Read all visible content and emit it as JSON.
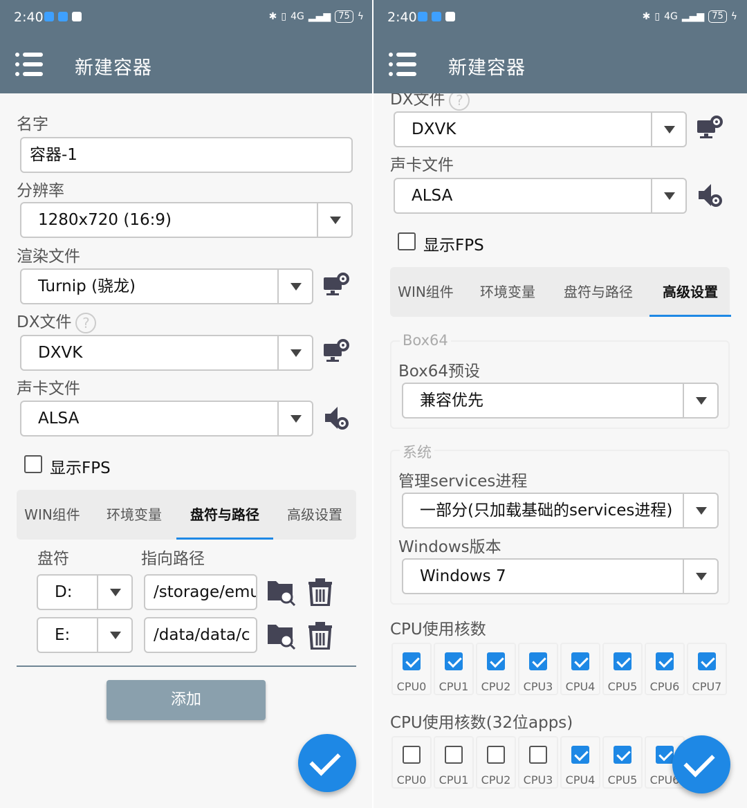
{
  "status": {
    "time": "2:40",
    "network": "4G",
    "battery": "75"
  },
  "appbar": {
    "title": "新建容器"
  },
  "left": {
    "name_label": "名字",
    "name_value": "容器-1",
    "resolution_label": "分辨率",
    "resolution_value": "1280x720 (16:9)",
    "renderer_label": "渲染文件",
    "renderer_value": "Turnip (骁龙)",
    "dx_label": "DX文件",
    "dx_value": "DXVK",
    "audio_label": "声卡文件",
    "audio_value": "ALSA",
    "fps_label": "显示FPS",
    "tabs": [
      "WIN组件",
      "环境变量",
      "盘符与路径",
      "高级设置"
    ],
    "drive_header": "盘符",
    "path_header": "指向路径",
    "drives": [
      {
        "letter": "D:",
        "path": "/storage/emu"
      },
      {
        "letter": "E:",
        "path": "/data/data/c"
      }
    ],
    "add_label": "添加"
  },
  "right": {
    "dx_label": "DX文件",
    "dx_value": "DXVK",
    "audio_label": "声卡文件",
    "audio_value": "ALSA",
    "fps_label": "显示FPS",
    "tabs": [
      "WIN组件",
      "环境变量",
      "盘符与路径",
      "高级设置"
    ],
    "box64_group": "Box64",
    "box64_label": "Box64预设",
    "box64_value": "兼容优先",
    "system_group": "系统",
    "services_label": "管理services进程",
    "services_value": "一部分(只加载基础的services进程)",
    "windows_label": "Windows版本",
    "windows_value": "Windows 7",
    "cpu_label": "CPU使用核数",
    "cpu_cores": [
      {
        "name": "CPU0",
        "checked": true
      },
      {
        "name": "CPU1",
        "checked": true
      },
      {
        "name": "CPU2",
        "checked": true
      },
      {
        "name": "CPU3",
        "checked": true
      },
      {
        "name": "CPU4",
        "checked": true
      },
      {
        "name": "CPU5",
        "checked": true
      },
      {
        "name": "CPU6",
        "checked": true
      },
      {
        "name": "CPU7",
        "checked": true
      }
    ],
    "cpu32_label": "CPU使用核数(32位apps)",
    "cpu32_cores": [
      {
        "name": "CPU0",
        "checked": false
      },
      {
        "name": "CPU1",
        "checked": false
      },
      {
        "name": "CPU2",
        "checked": false
      },
      {
        "name": "CPU3",
        "checked": false
      },
      {
        "name": "CPU4",
        "checked": true
      },
      {
        "name": "CPU5",
        "checked": true
      },
      {
        "name": "CPU6",
        "checked": true
      }
    ]
  },
  "colors": {
    "appbar": "#5f7585",
    "accent": "#1e88e5",
    "add_button": "#8aa0ad"
  }
}
